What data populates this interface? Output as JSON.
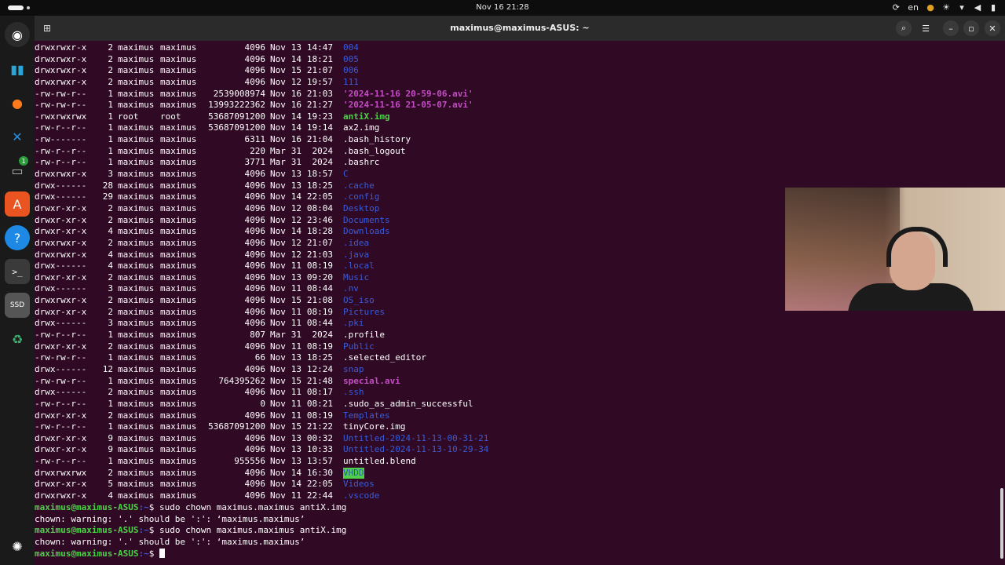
{
  "topbar": {
    "clock": "Nov 16  21:28",
    "lang": "en"
  },
  "dock": {
    "badge": "1",
    "icons": [
      "obs-icon",
      "files-blue-icon",
      "firefox-icon",
      "vscode-icon",
      "files-icon",
      "app-center-icon",
      "help-icon",
      "terminal-icon",
      "ssd-drive-icon",
      "trash-icon",
      "ubuntu-apps-icon"
    ]
  },
  "window": {
    "title": "maximus@maximus-ASUS: ~"
  },
  "listing": [
    {
      "perm": "drwxrwxr-x",
      "links": "2",
      "owner": "maximus",
      "group": "maximus",
      "size": "4096",
      "mon": "Nov",
      "day": "13",
      "time": "14:47",
      "name": "004",
      "type": "dir"
    },
    {
      "perm": "drwxrwxr-x",
      "links": "2",
      "owner": "maximus",
      "group": "maximus",
      "size": "4096",
      "mon": "Nov",
      "day": "14",
      "time": "18:21",
      "name": "005",
      "type": "dir"
    },
    {
      "perm": "drwxrwxr-x",
      "links": "2",
      "owner": "maximus",
      "group": "maximus",
      "size": "4096",
      "mon": "Nov",
      "day": "15",
      "time": "21:07",
      "name": "006",
      "type": "dir"
    },
    {
      "perm": "drwxrwxr-x",
      "links": "2",
      "owner": "maximus",
      "group": "maximus",
      "size": "4096",
      "mon": "Nov",
      "day": "12",
      "time": "19:57",
      "name": "111",
      "type": "dir"
    },
    {
      "perm": "-rw-rw-r--",
      "links": "1",
      "owner": "maximus",
      "group": "maximus",
      "size": "2539008974",
      "mon": "Nov",
      "day": "16",
      "time": "21:03",
      "name": "'2024-11-16 20-59-06.avi'",
      "type": "quoted"
    },
    {
      "perm": "-rw-rw-r--",
      "links": "1",
      "owner": "maximus",
      "group": "maximus",
      "size": "13993222362",
      "mon": "Nov",
      "day": "16",
      "time": "21:27",
      "name": "'2024-11-16 21-05-07.avi'",
      "type": "quoted"
    },
    {
      "perm": "-rwxrwxrwx",
      "links": "1",
      "owner": "root",
      "group": "root",
      "size": "53687091200",
      "mon": "Nov",
      "day": "14",
      "time": "19:23",
      "name": "antiX.img",
      "type": "exec"
    },
    {
      "perm": "-rw-r--r--",
      "links": "1",
      "owner": "maximus",
      "group": "maximus",
      "size": "53687091200",
      "mon": "Nov",
      "day": "14",
      "time": "19:14",
      "name": "ax2.img",
      "type": "file"
    },
    {
      "perm": "-rw-------",
      "links": "1",
      "owner": "maximus",
      "group": "maximus",
      "size": "6311",
      "mon": "Nov",
      "day": "16",
      "time": "21:04",
      "name": ".bash_history",
      "type": "file"
    },
    {
      "perm": "-rw-r--r--",
      "links": "1",
      "owner": "maximus",
      "group": "maximus",
      "size": "220",
      "mon": "Mar",
      "day": "31",
      "time": "2024",
      "name": ".bash_logout",
      "type": "file"
    },
    {
      "perm": "-rw-r--r--",
      "links": "1",
      "owner": "maximus",
      "group": "maximus",
      "size": "3771",
      "mon": "Mar",
      "day": "31",
      "time": "2024",
      "name": ".bashrc",
      "type": "file"
    },
    {
      "perm": "drwxrwxr-x",
      "links": "3",
      "owner": "maximus",
      "group": "maximus",
      "size": "4096",
      "mon": "Nov",
      "day": "13",
      "time": "18:57",
      "name": "C",
      "type": "dir"
    },
    {
      "perm": "drwx------",
      "links": "28",
      "owner": "maximus",
      "group": "maximus",
      "size": "4096",
      "mon": "Nov",
      "day": "13",
      "time": "18:25",
      "name": ".cache",
      "type": "dir"
    },
    {
      "perm": "drwx------",
      "links": "29",
      "owner": "maximus",
      "group": "maximus",
      "size": "4096",
      "mon": "Nov",
      "day": "14",
      "time": "22:05",
      "name": ".config",
      "type": "dir"
    },
    {
      "perm": "drwxr-xr-x",
      "links": "2",
      "owner": "maximus",
      "group": "maximus",
      "size": "4096",
      "mon": "Nov",
      "day": "12",
      "time": "08:04",
      "name": "Desktop",
      "type": "dir"
    },
    {
      "perm": "drwxr-xr-x",
      "links": "2",
      "owner": "maximus",
      "group": "maximus",
      "size": "4096",
      "mon": "Nov",
      "day": "12",
      "time": "23:46",
      "name": "Documents",
      "type": "dir"
    },
    {
      "perm": "drwxr-xr-x",
      "links": "4",
      "owner": "maximus",
      "group": "maximus",
      "size": "4096",
      "mon": "Nov",
      "day": "14",
      "time": "18:28",
      "name": "Downloads",
      "type": "dir"
    },
    {
      "perm": "drwxrwxr-x",
      "links": "2",
      "owner": "maximus",
      "group": "maximus",
      "size": "4096",
      "mon": "Nov",
      "day": "12",
      "time": "21:07",
      "name": ".idea",
      "type": "dir"
    },
    {
      "perm": "drwxrwxr-x",
      "links": "4",
      "owner": "maximus",
      "group": "maximus",
      "size": "4096",
      "mon": "Nov",
      "day": "12",
      "time": "21:03",
      "name": ".java",
      "type": "dir"
    },
    {
      "perm": "drwx------",
      "links": "4",
      "owner": "maximus",
      "group": "maximus",
      "size": "4096",
      "mon": "Nov",
      "day": "11",
      "time": "08:19",
      "name": ".local",
      "type": "dir"
    },
    {
      "perm": "drwxr-xr-x",
      "links": "2",
      "owner": "maximus",
      "group": "maximus",
      "size": "4096",
      "mon": "Nov",
      "day": "13",
      "time": "09:20",
      "name": "Music",
      "type": "dir"
    },
    {
      "perm": "drwx------",
      "links": "3",
      "owner": "maximus",
      "group": "maximus",
      "size": "4096",
      "mon": "Nov",
      "day": "11",
      "time": "08:44",
      "name": ".nv",
      "type": "dir"
    },
    {
      "perm": "drwxrwxr-x",
      "links": "2",
      "owner": "maximus",
      "group": "maximus",
      "size": "4096",
      "mon": "Nov",
      "day": "15",
      "time": "21:08",
      "name": "OS_iso",
      "type": "dir"
    },
    {
      "perm": "drwxr-xr-x",
      "links": "2",
      "owner": "maximus",
      "group": "maximus",
      "size": "4096",
      "mon": "Nov",
      "day": "11",
      "time": "08:19",
      "name": "Pictures",
      "type": "dir"
    },
    {
      "perm": "drwx------",
      "links": "3",
      "owner": "maximus",
      "group": "maximus",
      "size": "4096",
      "mon": "Nov",
      "day": "11",
      "time": "08:44",
      "name": ".pki",
      "type": "dir"
    },
    {
      "perm": "-rw-r--r--",
      "links": "1",
      "owner": "maximus",
      "group": "maximus",
      "size": "807",
      "mon": "Mar",
      "day": "31",
      "time": "2024",
      "name": ".profile",
      "type": "file"
    },
    {
      "perm": "drwxr-xr-x",
      "links": "2",
      "owner": "maximus",
      "group": "maximus",
      "size": "4096",
      "mon": "Nov",
      "day": "11",
      "time": "08:19",
      "name": "Public",
      "type": "dir"
    },
    {
      "perm": "-rw-rw-r--",
      "links": "1",
      "owner": "maximus",
      "group": "maximus",
      "size": "66",
      "mon": "Nov",
      "day": "13",
      "time": "18:25",
      "name": ".selected_editor",
      "type": "file"
    },
    {
      "perm": "drwx------",
      "links": "12",
      "owner": "maximus",
      "group": "maximus",
      "size": "4096",
      "mon": "Nov",
      "day": "13",
      "time": "12:24",
      "name": "snap",
      "type": "dir"
    },
    {
      "perm": "-rw-rw-r--",
      "links": "1",
      "owner": "maximus",
      "group": "maximus",
      "size": "764395262",
      "mon": "Nov",
      "day": "15",
      "time": "21:48",
      "name": "special.avi",
      "type": "media"
    },
    {
      "perm": "drwx------",
      "links": "2",
      "owner": "maximus",
      "group": "maximus",
      "size": "4096",
      "mon": "Nov",
      "day": "11",
      "time": "08:17",
      "name": ".ssh",
      "type": "dir"
    },
    {
      "perm": "-rw-r--r--",
      "links": "1",
      "owner": "maximus",
      "group": "maximus",
      "size": "0",
      "mon": "Nov",
      "day": "11",
      "time": "08:21",
      "name": ".sudo_as_admin_successful",
      "type": "file"
    },
    {
      "perm": "drwxr-xr-x",
      "links": "2",
      "owner": "maximus",
      "group": "maximus",
      "size": "4096",
      "mon": "Nov",
      "day": "11",
      "time": "08:19",
      "name": "Templates",
      "type": "dir"
    },
    {
      "perm": "-rw-r--r--",
      "links": "1",
      "owner": "maximus",
      "group": "maximus",
      "size": "53687091200",
      "mon": "Nov",
      "day": "15",
      "time": "21:22",
      "name": "tinyCore.img",
      "type": "file"
    },
    {
      "perm": "drwxr-xr-x",
      "links": "9",
      "owner": "maximus",
      "group": "maximus",
      "size": "4096",
      "mon": "Nov",
      "day": "13",
      "time": "00:32",
      "name": "Untitled-2024-11-13-00-31-21",
      "type": "dir"
    },
    {
      "perm": "drwxr-xr-x",
      "links": "9",
      "owner": "maximus",
      "group": "maximus",
      "size": "4096",
      "mon": "Nov",
      "day": "13",
      "time": "10:33",
      "name": "Untitled-2024-11-13-10-29-34",
      "type": "dir"
    },
    {
      "perm": "-rw-r--r--",
      "links": "1",
      "owner": "maximus",
      "group": "maximus",
      "size": "955556",
      "mon": "Nov",
      "day": "13",
      "time": "13:57",
      "name": "untitled.blend",
      "type": "file"
    },
    {
      "perm": "drwxrwxrwx",
      "links": "2",
      "owner": "maximus",
      "group": "maximus",
      "size": "4096",
      "mon": "Nov",
      "day": "14",
      "time": "16:30",
      "name": "VHDD",
      "type": "otherw"
    },
    {
      "perm": "drwxr-xr-x",
      "links": "5",
      "owner": "maximus",
      "group": "maximus",
      "size": "4096",
      "mon": "Nov",
      "day": "14",
      "time": "22:05",
      "name": "Videos",
      "type": "dir"
    },
    {
      "perm": "drwxrwxr-x",
      "links": "4",
      "owner": "maximus",
      "group": "maximus",
      "size": "4096",
      "mon": "Nov",
      "day": "11",
      "time": "22:44",
      "name": ".vscode",
      "type": "dir"
    }
  ],
  "commands": [
    {
      "user": "maximus@maximus-ASUS",
      "path": ":~",
      "symbol": "$ ",
      "cmd": "sudo chown maximus.maximus antiX.img",
      "output": "chown: warning: '.' should be ':': ‘maximus.maximus’"
    },
    {
      "user": "maximus@maximus-ASUS",
      "path": ":~",
      "symbol": "$ ",
      "cmd": "sudo chown maximus.maximus antiX.img",
      "output": "chown: warning: '.' should be ':': ‘maximus.maximus’"
    }
  ],
  "final_prompt": {
    "user": "maximus@maximus-ASUS",
    "path": ":~",
    "symbol": "$ "
  },
  "colors": {
    "terminal_bg": "#300a24",
    "directory": "#3a5bd8",
    "executable": "#4fd04a",
    "media": "#c64ac8"
  }
}
